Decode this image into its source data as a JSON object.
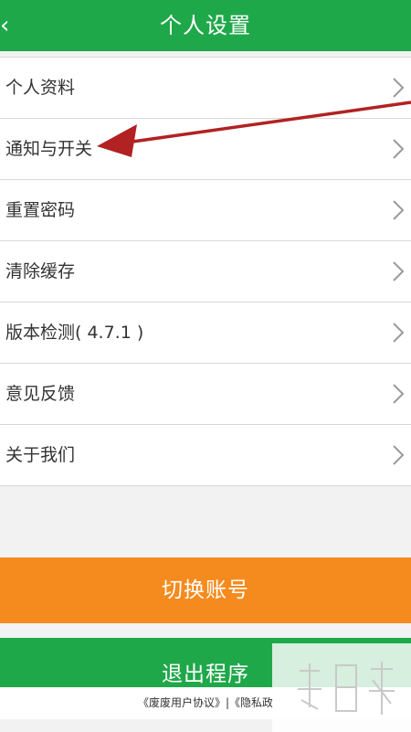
{
  "header": {
    "back_icon": "‹",
    "title": "个人设置"
  },
  "menu": {
    "items": [
      {
        "label": "个人资料"
      },
      {
        "label": "通知与开关"
      },
      {
        "label": "重置密码"
      },
      {
        "label": "清除缓存"
      },
      {
        "label": "版本检测( 4.7.1 )"
      },
      {
        "label": "意见反馈"
      },
      {
        "label": "关于我们"
      }
    ],
    "chevron_icon": "chevron-right-icon"
  },
  "buttons": {
    "switch_account": "切换账号",
    "exit_program": "退出程序"
  },
  "footer": {
    "agreement_text": "《废废用户协议》|《隐私政"
  },
  "colors": {
    "header_green": "#1fa84a",
    "switch_orange": "#f58b1e",
    "exit_green": "#1fa84a",
    "annotation_red": "#b22222"
  }
}
